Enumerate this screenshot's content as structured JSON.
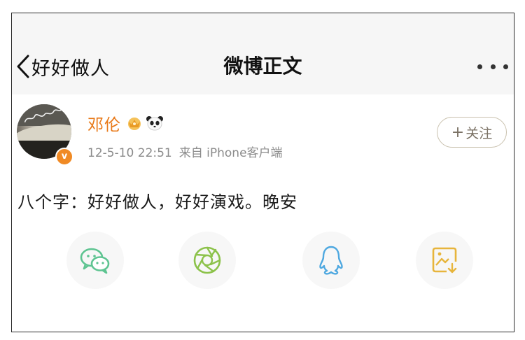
{
  "header": {
    "back_label": "好好做人",
    "title": "微博正文"
  },
  "post": {
    "author": "邓伦",
    "verified_badge": "v",
    "time": "12-5-10 22:51",
    "source": "来自 iPhone客户端",
    "follow_plus": "+",
    "follow_label": "关注",
    "text": "八个字：好好做人，好好演戏。晚安"
  },
  "share": {
    "icons": [
      "wechat-icon",
      "moments-icon",
      "qq-icon",
      "save-image-icon"
    ]
  },
  "colors": {
    "author": "#e87817",
    "wechat": "#5ec491",
    "moments": "#8cc24a",
    "qq": "#4ea8e0",
    "save": "#e7b53c"
  }
}
